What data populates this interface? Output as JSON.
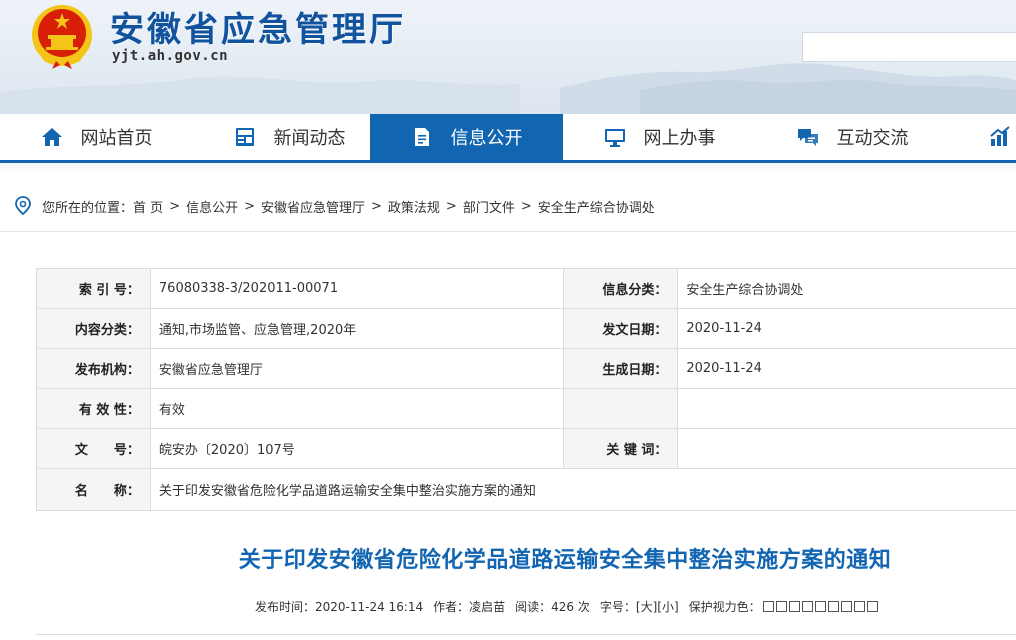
{
  "header": {
    "title": "安徽省应急管理厅",
    "url": "yjt.ah.gov.cn",
    "search_placeholder": ""
  },
  "nav": {
    "items": [
      {
        "label": "网站首页",
        "icon": "home-icon"
      },
      {
        "label": "新闻动态",
        "icon": "news-icon"
      },
      {
        "label": "信息公开",
        "icon": "document-icon",
        "active": true
      },
      {
        "label": "网上办事",
        "icon": "monitor-icon"
      },
      {
        "label": "互动交流",
        "icon": "chat-icon"
      },
      {
        "label": "",
        "icon": "chart-icon"
      }
    ]
  },
  "breadcrumb": {
    "prefix": "您所在的位置：",
    "items": [
      "首 页",
      "信息公开",
      "安徽省应急管理厅",
      "政策法规",
      "部门文件",
      "安全生产综合协调处"
    ],
    "separator": ">"
  },
  "info": {
    "index_label": "索 引 号：",
    "index_value": "76080338-3/202011-00071",
    "category_label": "信息分类：",
    "category_value": "安全生产综合协调处",
    "content_label": "内容分类：",
    "content_value": "通知,市场监管、应急管理,2020年",
    "issue_date_label": "发文日期：",
    "issue_date_value": "2020-11-24",
    "publisher_label": "发布机构：",
    "publisher_value": "安徽省应急管理厅",
    "created_label": "生成日期：",
    "created_value": "2020-11-24",
    "validity_label": "有 效 性：",
    "validity_value": "有效",
    "docno_label": "文　　号：",
    "docno_value": "皖安办〔2020〕107号",
    "keywords_label": "关 键 词：",
    "keywords_value": "",
    "name_label": "名　　称：",
    "name_value": "关于印发安徽省危险化学品道路运输安全集中整治实施方案的通知"
  },
  "article": {
    "title": "关于印发安徽省危险化学品道路运输安全集中整治实施方案的通知",
    "publish_time": "发布时间：2020-11-24 16:14",
    "author": "作者：凌启苗",
    "reads": "阅读：426 次",
    "font_label": "字号：",
    "font_large": "[大]",
    "font_small": "[小]",
    "eye_label": "保护视力色："
  },
  "colors": {
    "brand": "#1265b1",
    "title_blue": "#12539e",
    "emblem_red": "#d81e06",
    "emblem_gold": "#f4c518"
  }
}
